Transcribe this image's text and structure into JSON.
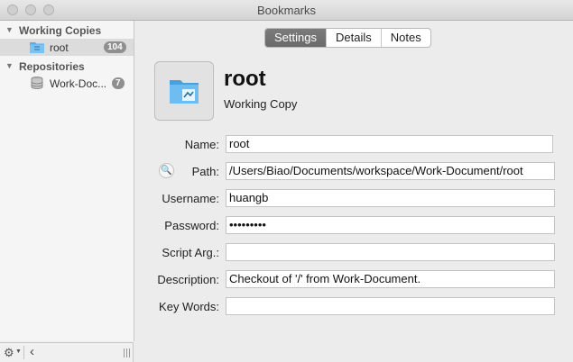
{
  "window": {
    "title": "Bookmarks"
  },
  "sidebar": {
    "groups": [
      {
        "label": "Working Copies",
        "items": [
          {
            "label": "root",
            "count": "104"
          }
        ]
      },
      {
        "label": "Repositories",
        "items": [
          {
            "label": "Work-Doc...",
            "count": "7"
          }
        ]
      }
    ]
  },
  "tabs": [
    "Settings",
    "Details",
    "Notes"
  ],
  "selected_tab": "Settings",
  "header": {
    "name": "root",
    "type": "Working Copy"
  },
  "form": {
    "name": {
      "label": "Name:",
      "value": "root"
    },
    "path": {
      "label": "Path:",
      "value": "/Users/Biao/Documents/workspace/Work-Document/root"
    },
    "username": {
      "label": "Username:",
      "value": "huangb"
    },
    "password": {
      "label": "Password:",
      "value": "•••••••••"
    },
    "script_arg": {
      "label": "Script Arg.:",
      "value": ""
    },
    "description": {
      "label": "Description:",
      "value": "Checkout of '/' from Work-Document."
    },
    "keywords": {
      "label": "Key Words:",
      "value": ""
    }
  },
  "icons": {
    "window_controls": [
      "close-icon",
      "minimize-icon",
      "zoom-icon"
    ],
    "working_copy": "folder-icon",
    "repository": "database-icon",
    "reveal": "magnifier-icon",
    "action": "gear-icon",
    "collapse": "chevron-left-icon",
    "resize": "grip-icon"
  },
  "colors": {
    "folder_blue": "#5aaee8",
    "badge_gray": "#8f8f8f",
    "active_tab": "#6f6f6f"
  }
}
